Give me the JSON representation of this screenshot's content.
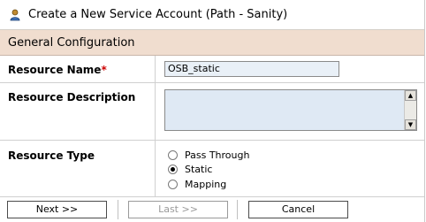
{
  "header": {
    "title": "Create a New Service Account (Path - Sanity)",
    "icon": "user-icon"
  },
  "section": {
    "title": "General Configuration"
  },
  "fields": {
    "resource_name": {
      "label": "Resource Name",
      "required_mark": "*",
      "value": "OSB_static"
    },
    "resource_description": {
      "label": "Resource Description",
      "value": ""
    },
    "resource_type": {
      "label": "Resource Type",
      "options": [
        {
          "label": "Pass Through",
          "selected": false
        },
        {
          "label": "Static",
          "selected": true
        },
        {
          "label": "Mapping",
          "selected": false
        }
      ]
    }
  },
  "buttons": {
    "next": "Next >>",
    "last": "Last >>",
    "cancel": "Cancel"
  },
  "colors": {
    "section_bg": "#f0ddcf",
    "input_bg": "#e9f0f7",
    "required": "#cc0000"
  }
}
